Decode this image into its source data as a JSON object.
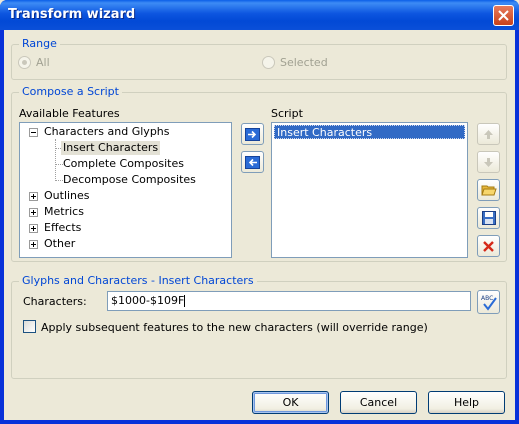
{
  "window": {
    "title": "Transform wizard"
  },
  "range": {
    "legend": "Range",
    "options": [
      {
        "label": "All",
        "checked": true
      },
      {
        "label": "Selected",
        "checked": false
      }
    ]
  },
  "compose": {
    "legend": "Compose a Script",
    "available_label": "Available Features",
    "script_label": "Script",
    "tree": {
      "group": "Characters and Glyphs",
      "children": [
        "Insert Characters",
        "Complete Composites",
        "Decompose Composites"
      ],
      "collapsed": [
        "Outlines",
        "Metrics",
        "Effects",
        "Other"
      ]
    },
    "script_items": [
      "Insert Characters"
    ]
  },
  "settings": {
    "legend": "Glyphs and Characters - Insert Characters",
    "characters_label": "Characters:",
    "characters_value": "$1000-$109F",
    "apply_label": "Apply subsequent features to the new characters (will override range)"
  },
  "buttons": {
    "ok": "OK",
    "cancel": "Cancel",
    "help": "Help"
  },
  "colors": {
    "accent": "#0046d5",
    "selection": "#316ac5",
    "titlebar": "#0a4fd8"
  }
}
